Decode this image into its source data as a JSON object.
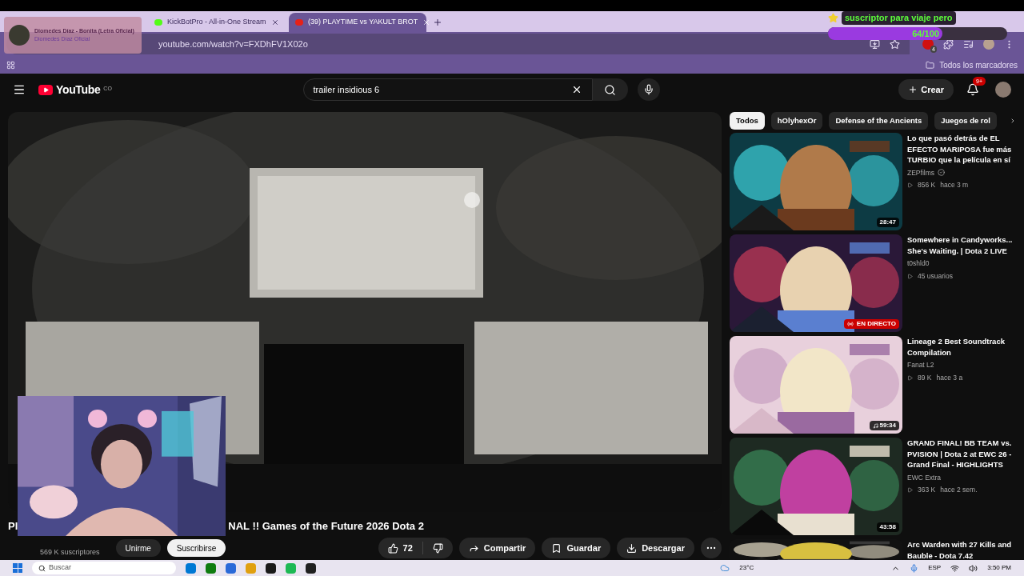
{
  "browser": {
    "tabs": [
      {
        "title": "KickBotPro - All-in-One Stream",
        "selected": false
      },
      {
        "title": "(39) PLAYTIME vs YAKULT BROT",
        "selected": true
      }
    ],
    "url": "youtube.com/watch?v=FXDhFV1X02o",
    "extension_badge": "4",
    "bookmarks_folder": "Todos los marcadores"
  },
  "stream_alert": {
    "song": "Diomedes Díaz - Bonita (Letra Oficial)",
    "artist": "Diomedes Díaz Oficial"
  },
  "goal": {
    "title": "suscriptor para viaje pero",
    "reading": "64/100",
    "level": 0.64
  },
  "youtube": {
    "logo": "YouTube",
    "region": "CO",
    "search": {
      "value": "trailer insidious 6"
    },
    "create": "Crear",
    "notifications": "9+"
  },
  "video": {
    "title_start": "Pl",
    "title_end": "NAL !! Games of the Future 2026 Dota 2",
    "subscribers": "569 K suscriptores",
    "join": "Unirme",
    "subscribe": "Suscribirse",
    "likes": "72",
    "share": "Compartir",
    "save": "Guardar",
    "download": "Descargar"
  },
  "chips": [
    {
      "label": "Todos",
      "selected": true
    },
    {
      "label": "hOlyhexOr",
      "selected": false
    },
    {
      "label": "Defense of the Ancients",
      "selected": false
    },
    {
      "label": "Juegos de rol",
      "selected": false
    }
  ],
  "recommendations": [
    {
      "kind": "video",
      "title": "Lo que pasó detrás de EL EFECTO MARIPOSA fue más TURBIO que la película en sí",
      "channel": "ZEPfilms",
      "verified": true,
      "views": "856 K",
      "age": "hace 3 m",
      "duration": "28:47"
    },
    {
      "kind": "live",
      "title": "Somewhere in Candyworks... She's Waiting. | Dota 2 LIVE",
      "channel": "t0shld0",
      "verified": false,
      "viewers": "45 usuarios",
      "badge": "EN DIRECTO"
    },
    {
      "kind": "music",
      "title": "Lineage 2 Best Soundtrack Compilation",
      "channel": "Fanat L2",
      "verified": false,
      "views": "89 K",
      "age": "hace 3 a",
      "duration": "59:34"
    },
    {
      "kind": "video",
      "title": "GRAND FINAL! BB TEAM vs. PVISION | Dota 2 at EWC 26 - Grand Final - HIGHLIGHTS",
      "channel": "EWC Extra",
      "verified": false,
      "views": "363 K",
      "age": "hace 2 sem.",
      "duration": "43:58"
    },
    {
      "kind": "partial",
      "title": "Arc Warden with 27 Kills and Bauble - Dota 7.42"
    }
  ],
  "taskbar": {
    "search": "Buscar",
    "weather": "23°C",
    "language": "ESP",
    "time": "3:50 PM"
  }
}
